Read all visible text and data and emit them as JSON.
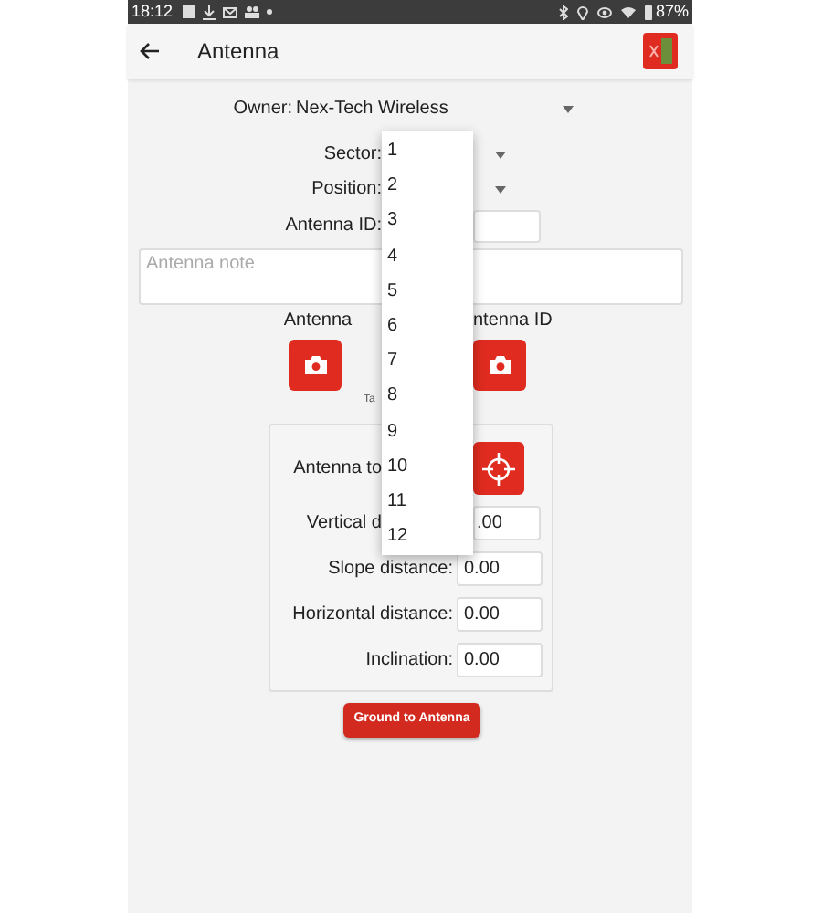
{
  "status_bar": {
    "time": "18:12",
    "battery": "87%"
  },
  "app_bar": {
    "title": "Antenna"
  },
  "form": {
    "owner": {
      "label": "Owner:",
      "value": "Nex-Tech Wireless"
    },
    "sector": {
      "label": "Sector:"
    },
    "position": {
      "label": "Position:"
    },
    "antenna_id": {
      "label": "Antenna ID:"
    },
    "note": {
      "placeholder": "Antenna note"
    },
    "photos": [
      {
        "label": "Antenna"
      },
      {
        "label": "ntenna ID"
      }
    ],
    "photo_hint": "Ta"
  },
  "measurement_card": {
    "target_label": "Antenna to",
    "fields": [
      {
        "kind": "covered",
        "label": "Vertical d",
        "value": ".00"
      },
      {
        "kind": "plain",
        "label": "Slope distance:",
        "value": "0.00"
      },
      {
        "kind": "plain",
        "label": "Horizontal distance:",
        "value": "0.00"
      },
      {
        "kind": "plain",
        "label": "Inclination:",
        "value": "0.00"
      }
    ],
    "button": "Ground to Antenna"
  },
  "dropdown": {
    "options": [
      "1",
      "2",
      "3",
      "4",
      "5",
      "6",
      "7",
      "8",
      "9",
      "10",
      "11",
      "12"
    ]
  }
}
